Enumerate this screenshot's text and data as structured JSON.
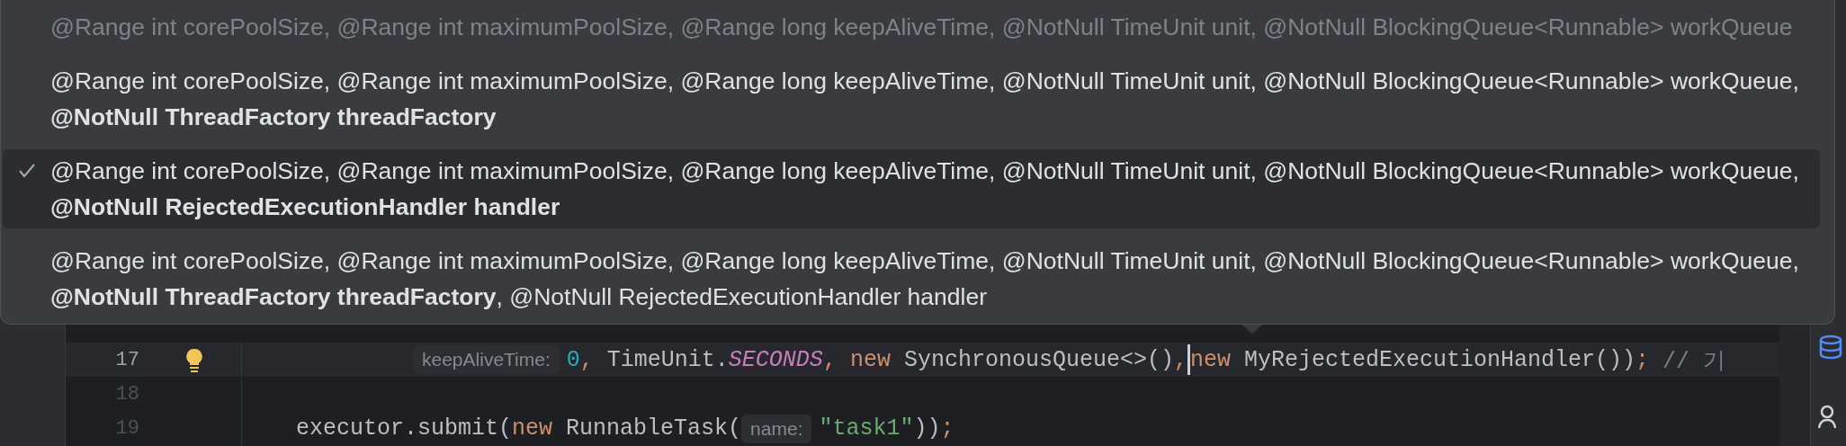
{
  "parameter_popup": {
    "overloads": [
      {
        "selected": false,
        "disabled": true,
        "lines": [
          {
            "text": "@Range int corePoolSize, @Range int maximumPoolSize, @Range long keepAliveTime, @NotNull TimeUnit unit, @NotNull BlockingQueue<Runnable> workQueue",
            "bold": false
          }
        ]
      },
      {
        "selected": false,
        "disabled": false,
        "lines": [
          {
            "text": "@Range int corePoolSize, @Range int maximumPoolSize, @Range long keepAliveTime, @NotNull TimeUnit unit, @NotNull BlockingQueue<Runnable> workQueue,",
            "bold": false
          },
          {
            "text": "@NotNull ThreadFactory threadFactory",
            "bold": true
          }
        ]
      },
      {
        "selected": true,
        "disabled": false,
        "lines": [
          {
            "text": "@Range int corePoolSize, @Range int maximumPoolSize, @Range long keepAliveTime, @NotNull TimeUnit unit, @NotNull BlockingQueue<Runnable> workQueue,",
            "bold": false
          },
          {
            "text": "@NotNull RejectedExecutionHandler handler",
            "bold": true
          }
        ]
      },
      {
        "selected": false,
        "disabled": false,
        "lines": [
          {
            "text": "@Range int corePoolSize, @Range int maximumPoolSize, @Range long keepAliveTime, @NotNull TimeUnit unit, @NotNull BlockingQueue<Runnable> workQueue,",
            "bold": false
          },
          {
            "text": "**@NotNull ThreadFactory threadFactory**, @NotNull RejectedExecutionHandler handler",
            "bold": false
          }
        ]
      }
    ]
  },
  "editor": {
    "lines": [
      {
        "number": "17",
        "current": true,
        "bulb": true,
        "kind": "continuation",
        "tokens": [
          {
            "kind": "hint",
            "text": "keepAliveTime:"
          },
          {
            "kind": "number",
            "text": "0"
          },
          {
            "kind": "keyword",
            "text": ","
          },
          {
            "kind": "plain",
            "text": " TimeUnit."
          },
          {
            "kind": "static",
            "text": "SECONDS"
          },
          {
            "kind": "keyword",
            "text": ", new"
          },
          {
            "kind": "plain",
            "text": " SynchronousQueue<>()"
          },
          {
            "kind": "keyword",
            "text": ","
          },
          {
            "kind": "caret"
          },
          {
            "kind": "keyword",
            "text": "new"
          },
          {
            "kind": "plain",
            "text": " MyRejectedExecutionHandler())"
          },
          {
            "kind": "keyword",
            "text": ";"
          },
          {
            "kind": "comment",
            "text": " // 기"
          }
        ]
      },
      {
        "number": "18",
        "current": false,
        "bulb": false,
        "kind": "code"
      },
      {
        "number": "19",
        "current": false,
        "bulb": false,
        "kind": "code",
        "tokens": [
          {
            "kind": "plain",
            "text": "executor.submit("
          },
          {
            "kind": "keyword",
            "text": "new"
          },
          {
            "kind": "plain",
            "text": " RunnableTask("
          },
          {
            "kind": "hint",
            "text": "name:"
          },
          {
            "kind": "string",
            "text": "\"task1\""
          },
          {
            "kind": "plain",
            "text": "))"
          },
          {
            "kind": "keyword",
            "text": ";"
          }
        ]
      }
    ]
  }
}
